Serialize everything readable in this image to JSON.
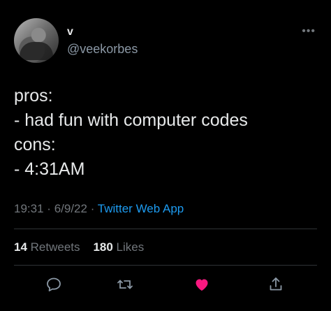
{
  "tweet": {
    "display_name": "v",
    "handle": "@veekorbes",
    "more_icon": "more-horizontal-icon",
    "lines": [
      "pros:",
      "- had fun with computer codes",
      "cons:",
      "- 4:31AM"
    ],
    "time": "19:31",
    "date": "6/9/22",
    "separator": "·",
    "source": "Twitter Web App",
    "retweets_count": "14",
    "retweets_label": "Retweets",
    "likes_count": "180",
    "likes_label": "Likes"
  },
  "actions": {
    "reply_icon": "reply-icon",
    "retweet_icon": "retweet-icon",
    "like_icon": "heart-icon",
    "share_icon": "share-icon"
  },
  "colors": {
    "background": "#000000",
    "text": "#e7e9ea",
    "muted": "#71767b",
    "link": "#1d9bf0",
    "like": "#f91880"
  }
}
